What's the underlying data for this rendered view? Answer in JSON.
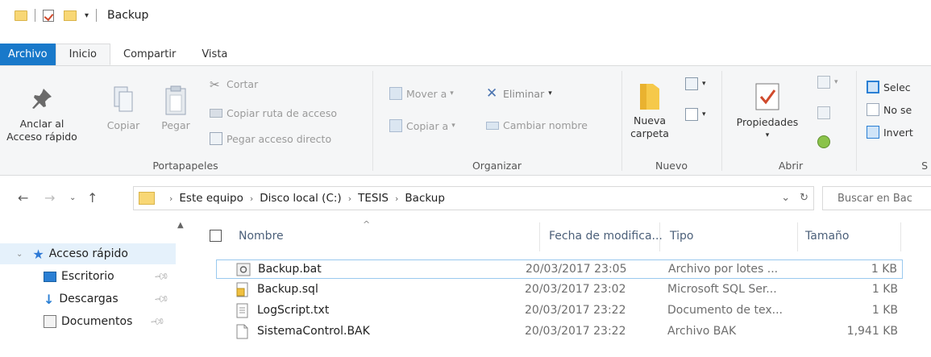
{
  "titlebar": {
    "title": "Backup",
    "qa_dropdown": "▾"
  },
  "tabs": [
    {
      "label": "Archivo"
    },
    {
      "label": "Inicio"
    },
    {
      "label": "Compartir"
    },
    {
      "label": "Vista"
    }
  ],
  "ribbon": {
    "portapapeles": {
      "label": "Portapapeles",
      "pin_label_1": "Anclar al",
      "pin_label_2": "Acceso rápido",
      "copy_label": "Copiar",
      "paste_label": "Pegar",
      "cut_label": "Cortar",
      "copy_path_label": "Copiar ruta de acceso",
      "paste_shortcut_label": "Pegar acceso directo"
    },
    "organizar": {
      "label": "Organizar",
      "move_label": "Mover a",
      "copy_to_label": "Copiar a",
      "delete_label": "Eliminar",
      "rename_label": "Cambiar nombre"
    },
    "nuevo": {
      "label": "Nuevo",
      "new_folder_1": "Nueva",
      "new_folder_2": "carpeta"
    },
    "abrir": {
      "label": "Abrir",
      "properties_label": "Propiedades"
    },
    "seleccionar": {
      "label": "S",
      "select_all": "Selec",
      "select_none": "No se",
      "invert": "Invert"
    }
  },
  "address": {
    "crumbs": [
      "Este equipo",
      "Disco local (C:)",
      "TESIS",
      "Backup"
    ],
    "search_placeholder": "Buscar en Bac"
  },
  "navpane": {
    "items": [
      {
        "label": "Acceso rápido"
      },
      {
        "label": "Escritorio"
      },
      {
        "label": "Descargas"
      },
      {
        "label": "Documentos"
      }
    ]
  },
  "filelist": {
    "columns": {
      "name": "Nombre",
      "date": "Fecha de modifica...",
      "type": "Tipo",
      "size": "Tamaño"
    },
    "rows": [
      {
        "name": "Backup.bat",
        "date": "20/03/2017 23:05",
        "type": "Archivo por lotes ...",
        "size": "1 KB"
      },
      {
        "name": "Backup.sql",
        "date": "20/03/2017 23:02",
        "type": "Microsoft SQL Ser...",
        "size": "1 KB"
      },
      {
        "name": "LogScript.txt",
        "date": "20/03/2017 23:22",
        "type": "Documento de tex...",
        "size": "1 KB"
      },
      {
        "name": "SistemaControl.BAK",
        "date": "20/03/2017 23:22",
        "type": "Archivo BAK",
        "size": "1,941 KB"
      }
    ]
  },
  "colors": {
    "accent": "#1979ca",
    "folder": "#f8d775",
    "ribbon_bg": "#f5f6f7",
    "selection": "#e5f1fb"
  }
}
